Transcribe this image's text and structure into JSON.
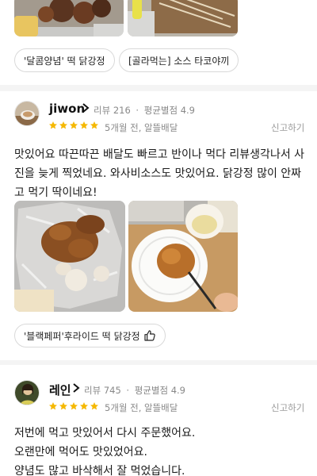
{
  "colors": {
    "star": "#f5b800",
    "accent": "#f5b800"
  },
  "top_tags": [
    {
      "label": "'달콤양념' 떡 닭강정"
    },
    {
      "label": "[골라먹는] 소스 타코야끼"
    }
  ],
  "reviews": [
    {
      "name": "jiwon",
      "review_count_label": "리뷰 216",
      "sep": "·",
      "avg_rating_label": "평균별점 4.9",
      "stars": 5,
      "date": "5개월 전, 알뜰배달",
      "report": "신고하기",
      "text": "맛있어요 따끈따끈 배달도 빠르고 반이나 먹다 리뷰생각나서 사\n진을 늦게 찍었네요. 와사비소스도 맛있어요. 닭강정 많이 안짜\n고 먹기 딱이네요!",
      "tag": "'블랙페퍼'후라이드 떡 닭강정",
      "tag_icon": "thumbs-up-icon"
    },
    {
      "name": "레인",
      "review_count_label": "리뷰 745",
      "sep": "·",
      "avg_rating_label": "평균별점 4.9",
      "stars": 5,
      "date": "5개월 전, 알뜰배달",
      "report": "신고하기",
      "text": "저번에 먹고 맛있어서 다시 주문했어요.\n오랜만에 먹어도 맛있었어요.\n양념도 많고 바삭해서 잘 먹었습니다."
    }
  ]
}
